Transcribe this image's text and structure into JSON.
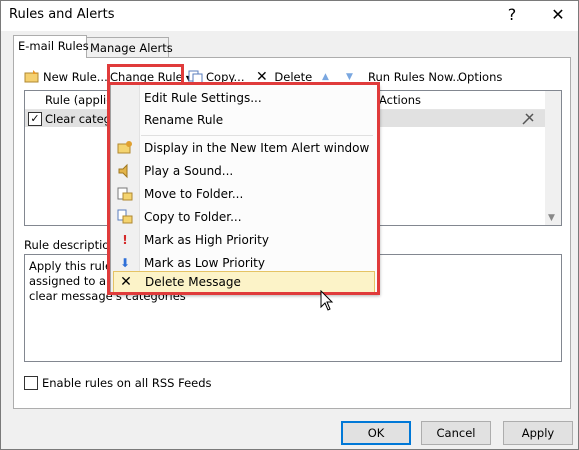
{
  "window": {
    "title": "Rules and Alerts",
    "help_glyph": "?",
    "close_glyph": "✕"
  },
  "tabs": [
    {
      "label": "E-mail Rules"
    },
    {
      "label": "Manage Alerts"
    }
  ],
  "toolbar": {
    "new_rule": "New Rule...",
    "change_rule": "Change Rule",
    "copy": "Copy...",
    "delete": "Delete",
    "run_rules_now": "Run Rules Now...",
    "options": "Options",
    "up_glyph": "▲",
    "down_glyph": "▼"
  },
  "rules_list": {
    "columns": [
      "Rule (applied",
      "Actions"
    ],
    "rows": [
      {
        "name": "Clear categor",
        "checked": true
      }
    ]
  },
  "rule_description": {
    "label": "Rule description (c",
    "lines": [
      "Apply this rule af",
      "assigned to any",
      "clear message's categories"
    ]
  },
  "rss_option": {
    "label": "Enable rules on all RSS Feeds",
    "checked": false
  },
  "buttons": {
    "ok": "OK",
    "cancel": "Cancel",
    "apply": "Apply"
  },
  "menu": {
    "items": [
      {
        "label": "Edit Rule Settings...",
        "icon": ""
      },
      {
        "label": "Rename Rule",
        "icon": ""
      },
      {
        "label": "Display in the New Item Alert window",
        "icon": "new-item-alert-icon"
      },
      {
        "label": "Play a Sound...",
        "icon": "speaker-icon"
      },
      {
        "label": "Move to Folder...",
        "icon": "move-folder-icon"
      },
      {
        "label": "Copy to Folder...",
        "icon": "copy-folder-icon"
      },
      {
        "label": "Mark as High Priority",
        "icon": "high-priority-icon"
      },
      {
        "label": "Mark as Low Priority",
        "icon": "low-priority-icon"
      },
      {
        "label": "Delete Message",
        "icon": "delete-x-icon"
      }
    ],
    "highlighted_index": 8
  },
  "colors": {
    "highlight_box": "#e03b3b",
    "menu_hover": "#fcf3c8"
  }
}
